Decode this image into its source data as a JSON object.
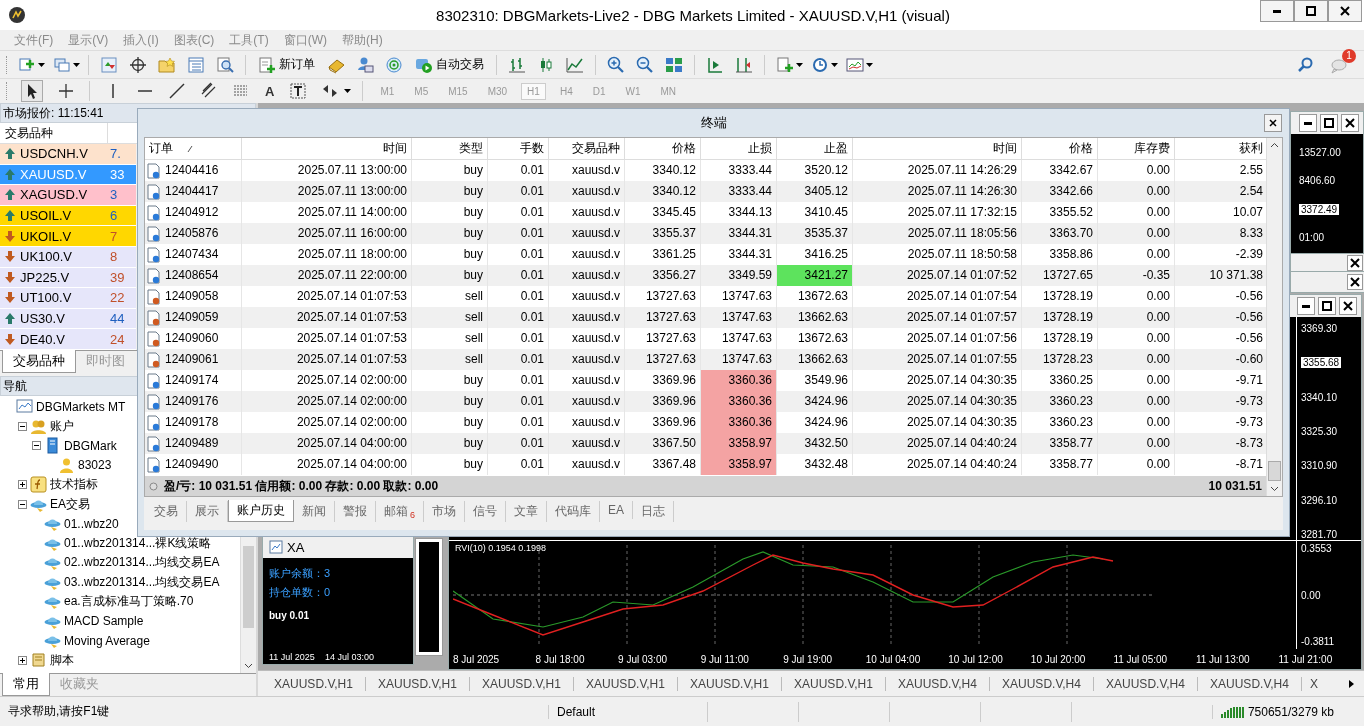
{
  "window": {
    "title": "8302310: DBGMarkets-Live2 - DBG Markets Limited - XAUUSD.V,H1 (visual)"
  },
  "menu": [
    "文件(F)",
    "显示(V)",
    "插入(I)",
    "图表(C)",
    "工具(T)",
    "窗口(W)",
    "帮助(H)"
  ],
  "toolbar": {
    "buttons": [
      "新订单",
      "自动交易"
    ],
    "notification_count": "1"
  },
  "drawing_toolbar": {
    "text_tool": "A",
    "timeframes": [
      {
        "label": "M1",
        "selected": false
      },
      {
        "label": "M5",
        "selected": false
      },
      {
        "label": "M15",
        "selected": false
      },
      {
        "label": "M30",
        "selected": false
      },
      {
        "label": "H1",
        "selected": true
      },
      {
        "label": "H4",
        "selected": false
      },
      {
        "label": "D1",
        "selected": false
      },
      {
        "label": "W1",
        "selected": false
      },
      {
        "label": "MN",
        "selected": false
      }
    ]
  },
  "market_watch": {
    "title": "市场报价: 11:15:41",
    "column": "交易品种",
    "rows": [
      {
        "symbol": "USDCNH.V",
        "price": "7.",
        "rising": true,
        "color": "#fde2cc",
        "selected": false
      },
      {
        "symbol": "XAUUSD.V",
        "price": "33",
        "rising": true,
        "color": "#3399ff",
        "selected": true
      },
      {
        "symbol": "XAGUSD.V",
        "price": "3",
        "rising": true,
        "color": "#ffc0cb",
        "selected": false
      },
      {
        "symbol": "USOIL.V",
        "price": "6",
        "rising": true,
        "color": "#ffd700",
        "selected": false
      },
      {
        "symbol": "UKOIL.V",
        "price": "7",
        "rising": false,
        "color": "#ffd700",
        "selected": false
      },
      {
        "symbol": "UK100.V",
        "price": "8",
        "rising": false,
        "color": "#e6e6fa",
        "selected": false
      },
      {
        "symbol": "JP225.V",
        "price": "39",
        "rising": false,
        "color": "#e6e6fa",
        "selected": false
      },
      {
        "symbol": "UT100.V",
        "price": "22",
        "rising": false,
        "color": "#e6e6fa",
        "selected": false
      },
      {
        "symbol": "US30.V",
        "price": "44",
        "rising": true,
        "color": "#e6e6fa",
        "selected": false
      },
      {
        "symbol": "DE40.V",
        "price": "24",
        "rising": false,
        "color": "#e6e6fa",
        "selected": false
      }
    ],
    "tabs": [
      {
        "label": "交易品种",
        "selected": true
      },
      {
        "label": "即时图",
        "selected": false
      }
    ]
  },
  "navigator": {
    "title": "导航",
    "tree": [
      {
        "label": "DBGMarkets MT",
        "kind": "terminal",
        "children": [
          {
            "label": "账户",
            "kind": "accounts",
            "expanded": true,
            "children": [
              {
                "label": "DBGMark",
                "kind": "server",
                "expanded": true,
                "children": [
                  {
                    "label": "83023",
                    "kind": "user"
                  }
                ]
              }
            ]
          },
          {
            "label": "技术指标",
            "kind": "indicators",
            "expanded": false
          },
          {
            "label": "EA交易",
            "kind": "experts",
            "expanded": true,
            "children": [
              {
                "label": "01..wbz20",
                "kind": "expert"
              },
              {
                "label": "01..wbz201314...裸K线策略",
                "kind": "expert"
              },
              {
                "label": "02..wbz201314...均线交易EA",
                "kind": "expert"
              },
              {
                "label": "03..wbz201314...均线交易EA",
                "kind": "expert"
              },
              {
                "label": "ea.言成标准马丁策略.70",
                "kind": "expert"
              },
              {
                "label": "MACD Sample",
                "kind": "expert"
              },
              {
                "label": "Moving Average",
                "kind": "expert"
              }
            ]
          },
          {
            "label": "脚本",
            "kind": "scripts",
            "expanded": false
          }
        ]
      }
    ],
    "tabs": [
      {
        "label": "常用",
        "selected": true
      },
      {
        "label": "收藏夹",
        "selected": false
      }
    ]
  },
  "terminal": {
    "title": "终端",
    "columns": [
      "订单",
      "时间",
      "类型",
      "手数",
      "交易品种",
      "价格",
      "止损",
      "止盈",
      "时间",
      "价格",
      "库存费",
      "获利"
    ],
    "rows": [
      {
        "kind": "buy",
        "order": "12404416",
        "open_time": "2025.07.11 13:00:00",
        "type": "buy",
        "lots": "0.01",
        "symbol": "xauusd.v",
        "open_price": "3340.12",
        "sl": "3333.44",
        "tp": "3520.12",
        "close_time": "2025.07.11 14:26:29",
        "close_price": "3342.67",
        "swap": "0.00",
        "profit": "2.55",
        "sl_hit": false,
        "tp_hit": false
      },
      {
        "kind": "buy",
        "order": "12404417",
        "open_time": "2025.07.11 13:00:00",
        "type": "buy",
        "lots": "0.01",
        "symbol": "xauusd.v",
        "open_price": "3340.12",
        "sl": "3333.44",
        "tp": "3405.12",
        "close_time": "2025.07.11 14:26:30",
        "close_price": "3342.66",
        "swap": "0.00",
        "profit": "2.54",
        "sl_hit": false,
        "tp_hit": false
      },
      {
        "kind": "buy",
        "order": "12404912",
        "open_time": "2025.07.11 14:00:00",
        "type": "buy",
        "lots": "0.01",
        "symbol": "xauusd.v",
        "open_price": "3345.45",
        "sl": "3344.13",
        "tp": "3410.45",
        "close_time": "2025.07.11 17:32:15",
        "close_price": "3355.52",
        "swap": "0.00",
        "profit": "10.07",
        "sl_hit": false,
        "tp_hit": false
      },
      {
        "kind": "buy",
        "order": "12405876",
        "open_time": "2025.07.11 16:00:00",
        "type": "buy",
        "lots": "0.01",
        "symbol": "xauusd.v",
        "open_price": "3355.37",
        "sl": "3344.31",
        "tp": "3535.37",
        "close_time": "2025.07.11 18:05:56",
        "close_price": "3363.70",
        "swap": "0.00",
        "profit": "8.33",
        "sl_hit": false,
        "tp_hit": false
      },
      {
        "kind": "buy",
        "order": "12407434",
        "open_time": "2025.07.11 18:00:00",
        "type": "buy",
        "lots": "0.01",
        "symbol": "xauusd.v",
        "open_price": "3361.25",
        "sl": "3344.31",
        "tp": "3416.25",
        "close_time": "2025.07.11 18:50:58",
        "close_price": "3358.86",
        "swap": "0.00",
        "profit": "-2.39",
        "sl_hit": false,
        "tp_hit": false
      },
      {
        "kind": "buy",
        "order": "12408654",
        "open_time": "2025.07.11 22:00:00",
        "type": "buy",
        "lots": "0.01",
        "symbol": "xauusd.v",
        "open_price": "3356.27",
        "sl": "3349.59",
        "tp": "3421.27",
        "close_time": "2025.07.14 01:07:52",
        "close_price": "13727.65",
        "swap": "-0.35",
        "profit": "10 371.38",
        "sl_hit": false,
        "tp_hit": true
      },
      {
        "kind": "sell",
        "order": "12409058",
        "open_time": "2025.07.14 01:07:53",
        "type": "sell",
        "lots": "0.01",
        "symbol": "xauusd.v",
        "open_price": "13727.63",
        "sl": "13747.63",
        "tp": "13672.63",
        "close_time": "2025.07.14 01:07:54",
        "close_price": "13728.19",
        "swap": "0.00",
        "profit": "-0.56",
        "sl_hit": false,
        "tp_hit": false
      },
      {
        "kind": "sell",
        "order": "12409059",
        "open_time": "2025.07.14 01:07:53",
        "type": "sell",
        "lots": "0.01",
        "symbol": "xauusd.v",
        "open_price": "13727.63",
        "sl": "13747.63",
        "tp": "13662.63",
        "close_time": "2025.07.14 01:07:57",
        "close_price": "13728.19",
        "swap": "0.00",
        "profit": "-0.56",
        "sl_hit": false,
        "tp_hit": false
      },
      {
        "kind": "sell",
        "order": "12409060",
        "open_time": "2025.07.14 01:07:53",
        "type": "sell",
        "lots": "0.01",
        "symbol": "xauusd.v",
        "open_price": "13727.63",
        "sl": "13747.63",
        "tp": "13672.63",
        "close_time": "2025.07.14 01:07:56",
        "close_price": "13728.19",
        "swap": "0.00",
        "profit": "-0.56",
        "sl_hit": false,
        "tp_hit": false
      },
      {
        "kind": "sell",
        "order": "12409061",
        "open_time": "2025.07.14 01:07:53",
        "type": "sell",
        "lots": "0.01",
        "symbol": "xauusd.v",
        "open_price": "13727.63",
        "sl": "13747.63",
        "tp": "13662.63",
        "close_time": "2025.07.14 01:07:55",
        "close_price": "13728.23",
        "swap": "0.00",
        "profit": "-0.60",
        "sl_hit": false,
        "tp_hit": false
      },
      {
        "kind": "buy",
        "order": "12409174",
        "open_time": "2025.07.14 02:00:00",
        "type": "buy",
        "lots": "0.01",
        "symbol": "xauusd.v",
        "open_price": "3369.96",
        "sl": "3360.36",
        "tp": "3549.96",
        "close_time": "2025.07.14 04:30:35",
        "close_price": "3360.25",
        "swap": "0.00",
        "profit": "-9.71",
        "sl_hit": true,
        "tp_hit": false
      },
      {
        "kind": "buy",
        "order": "12409176",
        "open_time": "2025.07.14 02:00:00",
        "type": "buy",
        "lots": "0.01",
        "symbol": "xauusd.v",
        "open_price": "3369.96",
        "sl": "3360.36",
        "tp": "3424.96",
        "close_time": "2025.07.14 04:30:35",
        "close_price": "3360.23",
        "swap": "0.00",
        "profit": "-9.73",
        "sl_hit": true,
        "tp_hit": false
      },
      {
        "kind": "buy",
        "order": "12409178",
        "open_time": "2025.07.14 02:00:00",
        "type": "buy",
        "lots": "0.01",
        "symbol": "xauusd.v",
        "open_price": "3369.96",
        "sl": "3360.36",
        "tp": "3424.96",
        "close_time": "2025.07.14 04:30:35",
        "close_price": "3360.23",
        "swap": "0.00",
        "profit": "-9.73",
        "sl_hit": true,
        "tp_hit": false
      },
      {
        "kind": "buy",
        "order": "12409489",
        "open_time": "2025.07.14 04:00:00",
        "type": "buy",
        "lots": "0.01",
        "symbol": "xauusd.v",
        "open_price": "3367.50",
        "sl": "3358.97",
        "tp": "3432.50",
        "close_time": "2025.07.14 04:40:24",
        "close_price": "3358.77",
        "swap": "0.00",
        "profit": "-8.73",
        "sl_hit": true,
        "tp_hit": false
      },
      {
        "kind": "buy",
        "order": "12409490",
        "open_time": "2025.07.14 04:00:00",
        "type": "buy",
        "lots": "0.01",
        "symbol": "xauusd.v",
        "open_price": "3367.48",
        "sl": "3358.97",
        "tp": "3432.48",
        "close_time": "2025.07.14 04:40:24",
        "close_price": "3358.77",
        "swap": "0.00",
        "profit": "-8.71",
        "sl_hit": true,
        "tp_hit": false
      }
    ],
    "summary": "盈/亏: 10 031.51  信用额: 0.00  存款: 0.00  取款: 0.00",
    "total": "10 031.51",
    "tabs": [
      {
        "label": "交易",
        "selected": false
      },
      {
        "label": "展示",
        "selected": false
      },
      {
        "label": "账户历史",
        "selected": true
      },
      {
        "label": "新闻",
        "selected": false
      },
      {
        "label": "警报",
        "selected": false
      },
      {
        "label": "邮箱",
        "selected": false,
        "badge": "6"
      },
      {
        "label": "市场",
        "selected": false
      },
      {
        "label": "信号",
        "selected": false
      },
      {
        "label": "文章",
        "selected": false
      },
      {
        "label": "代码库",
        "selected": false
      },
      {
        "label": "EA",
        "selected": false
      },
      {
        "label": "日志",
        "selected": false
      }
    ]
  },
  "charts": {
    "top_right": {
      "price_labels": [
        "13527.00",
        "8406.60"
      ],
      "current_price": "3372.49",
      "time_label": "01:00"
    },
    "main": {
      "price_labels": [
        {
          "text": "3369.30",
          "current": false
        },
        {
          "text": "3355.68",
          "current": true
        },
        {
          "text": "3340.10",
          "current": false
        },
        {
          "text": "3325.30",
          "current": false
        },
        {
          "text": "3310.90",
          "current": false
        },
        {
          "text": "3296.10",
          "current": false
        },
        {
          "text": "3281.70",
          "current": false
        }
      ],
      "indicator_title": "RVI(10) 0.1954 0.1998",
      "indicator_labels": [
        "0.3553",
        "0.00",
        "-0.3811"
      ],
      "time_labels": [
        "8 Jul 2025",
        "8 Jul 18:00",
        "9 Jul 03:00",
        "9 Jul 11:00",
        "9 Jul 19:00",
        "10 Jul 04:00",
        "10 Jul 12:00",
        "10 Jul 20:00",
        "11 Jul 05:00",
        "11 Jul 13:00",
        "11 Jul 21:00"
      ]
    },
    "mini": {
      "title": "XA",
      "lines": [
        "账户余额：3",
        "持仓单数：0"
      ],
      "order_label": "buy 0.01",
      "time_labels": [
        "11 Jul 2025",
        "14 Jul 03:00"
      ]
    }
  },
  "chart_tabs": [
    "XAUUSD.V,H1",
    "XAUUSD.V,H1",
    "XAUUSD.V,H1",
    "XAUUSD.V,H1",
    "XAUUSD.V,H1",
    "XAUUSD.V,H1",
    "XAUUSD.V,H4",
    "XAUUSD.V,H4",
    "XAUUSD.V,H4",
    "XAUUSD.V,H4",
    "X"
  ],
  "status_bar": {
    "help": "寻求帮助,请按F1键",
    "profile": "Default",
    "traffic": "750651/3279 kb"
  }
}
